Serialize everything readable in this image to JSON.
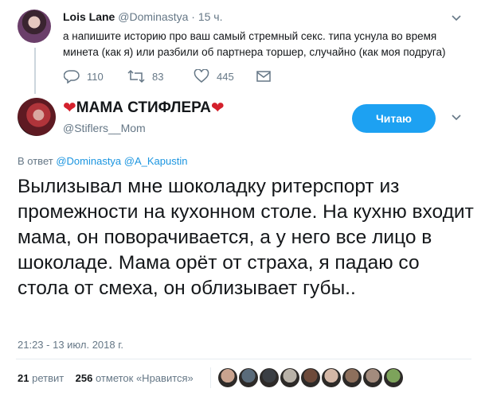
{
  "parent_tweet": {
    "name": "Lois Lane",
    "handle": "@Dominastya",
    "time": "15 ч.",
    "text": "а напишите историю про ваш самый стремный секс. типа уснула во время минета (как я) или разбили об партнера торшер, случайно (как моя подруга)",
    "replies": "110",
    "retweets": "83",
    "likes": "445",
    "icons": {
      "reply": "reply-icon",
      "retweet": "retweet-icon",
      "like": "heart-icon",
      "message": "envelope-icon",
      "menu": "chevron-down-icon"
    }
  },
  "main_tweet": {
    "name": "МАМА СТИФЛЕРА",
    "name_decoration": "❤",
    "handle": "@Stiflers__Mom",
    "follow_label": "Читаю",
    "reply_to_prefix": "В ответ",
    "reply_to_users": "@Dominastya @A_Kapustin",
    "text": "Вылизывал мне шоколадку ритерспорт из промежности на кухонном столе. На кухню входит мама, он поворачивается, а у  него все лицо в шоколаде. Мама орёт от страха, я падаю со стола от смеха, он облизывает губы..",
    "timestamp": "21:23 - 13 июл. 2018 г.",
    "retweet_count": "21",
    "retweet_label": "ретвит",
    "like_count": "256",
    "like_label": "отметок «Нравится»",
    "liker_colors": [
      "#c9a38f",
      "#5a6b7a",
      "#3b3f44",
      "#b9b2a8",
      "#6e4a3a",
      "#d4b7a6",
      "#8d6f5c",
      "#a38b7d",
      "#7da35b"
    ]
  },
  "colors": {
    "accent": "#1da1f2",
    "link": "#1b95e0",
    "muted": "#657786",
    "heart": "#d4202c"
  }
}
